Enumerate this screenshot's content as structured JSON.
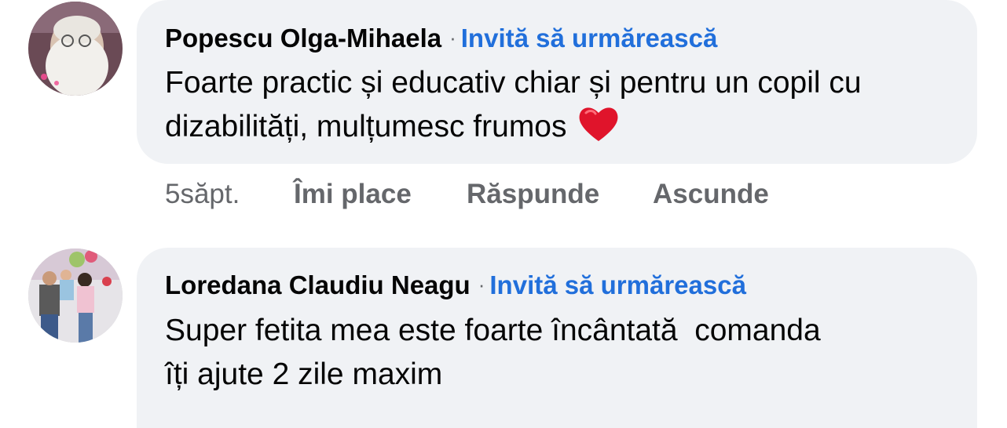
{
  "comments": [
    {
      "author": "Popescu Olga-Mihaela",
      "separator": "·",
      "follow_label": "Invită să urmărească",
      "text": "Foarte practic și educativ chiar și pentru un copil cu dizabilități, mulțumesc frumos",
      "emoji": "red-heart-emoji",
      "time": "5săpt.",
      "like_label": "Îmi place",
      "reply_label": "Răspunde",
      "hide_label": "Ascunde"
    },
    {
      "author": "Loredana Claudiu Neagu",
      "separator": "·",
      "follow_label": "Invită să urmărească",
      "text_line1": "Super fetita mea este foarte încântată  comanda",
      "text_line2": "îți ajute 2 zile maxim"
    }
  ],
  "colors": {
    "bubble": "#f0f2f5",
    "link_blue": "#216fdb",
    "secondary_text": "#65676b",
    "primary_text": "#050505",
    "heart": "#e0142b"
  }
}
